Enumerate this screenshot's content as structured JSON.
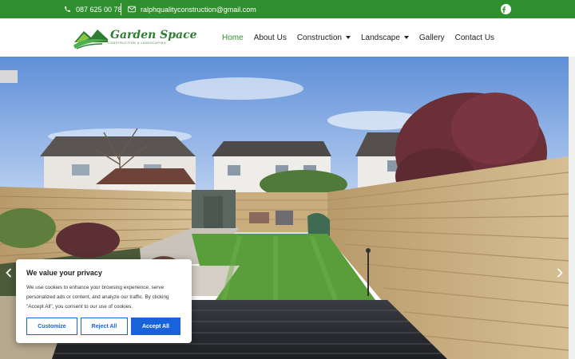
{
  "topbar": {
    "phone": "087 625 00 78",
    "email": "ralphqualityconstruction@gmail.com",
    "phone_icon": "phone-icon",
    "email_icon": "envelope-icon",
    "social_icon": "facebook-icon",
    "background": "#2f8f2f"
  },
  "logo": {
    "name": "Garden Space",
    "tagline": "CONSTRUCTION & LANDSCAPING"
  },
  "nav": {
    "items": [
      {
        "label": "Home",
        "active": true
      },
      {
        "label": "About Us"
      },
      {
        "label": "Construction",
        "dropdown": true
      },
      {
        "label": "Landscape",
        "dropdown": true
      },
      {
        "label": "Gallery"
      },
      {
        "label": "Contact Us"
      }
    ],
    "active_color": "#2f8f2f"
  },
  "hero": {
    "prev_icon": "chevron-left-icon",
    "next_icon": "chevron-right-icon"
  },
  "cookie": {
    "title": "We value your privacy",
    "text": "We use cookies to enhance your browsing experience, serve personalized ads or content, and analyze our traffic. By clicking \"Accept All\", you consent to our use of cookies.",
    "customize_label": "Customize",
    "reject_label": "Reject All",
    "accept_label": "Accept All",
    "accent": "#1863dc"
  }
}
